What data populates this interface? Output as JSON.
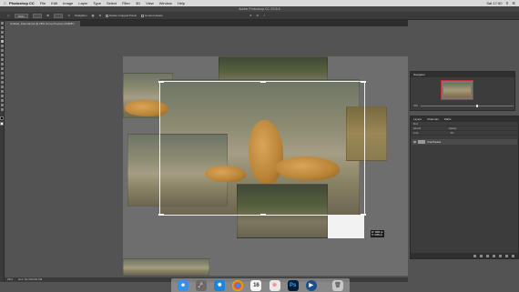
{
  "menubar": {
    "apple_icon": "apple-icon",
    "items": [
      "Photoshop CC",
      "File",
      "Edit",
      "Image",
      "Layer",
      "Type",
      "Select",
      "Filter",
      "3D",
      "View",
      "Window",
      "Help"
    ],
    "clock": "Sat 17:50"
  },
  "window": {
    "title": "Adobe Photoshop CC 2015.5"
  },
  "options": {
    "ratio_label": "Ratio",
    "straighten_label": "Straighten",
    "delete_pixels_label": "Delete Cropped Pixels",
    "content_aware_label": "Content-Aware"
  },
  "document_tab": {
    "label": "Untitled_Panorama1 @ 25% (Crop Preview, RGB/8*)"
  },
  "status": {
    "zoom": "25%",
    "doc_info": "Doc: 60.2M/240.9M"
  },
  "crop_info": {
    "line1": "W: 1680 px",
    "line2": "H: 1095 px"
  },
  "navigator": {
    "title": "Navigator",
    "zoom": "25%"
  },
  "layers": {
    "tabs": [
      "Layers",
      "Channels",
      "Paths"
    ],
    "kind_label": "Kind",
    "blend_mode": "Normal",
    "opacity_label": "Opacity:",
    "fill_label": "Fill:",
    "lock_label": "Lock:",
    "layer_name": "Crop Preview"
  },
  "dock": {
    "items": [
      {
        "icon": "finder-icon",
        "color": "#3b8ee8"
      },
      {
        "icon": "launchpad-icon",
        "color": "#6a6a6a"
      },
      {
        "icon": "safari-icon",
        "color": "#1a84e0"
      },
      {
        "icon": "chrome-icon",
        "color": "#db4437"
      },
      {
        "icon": "calendar-icon",
        "color": "#f5f5f5",
        "label": "16"
      },
      {
        "icon": "photos-icon",
        "color": "#e9e9e9"
      },
      {
        "icon": "photoshop-icon",
        "color": "#001e36",
        "label": "Ps"
      },
      {
        "icon": "quicktime-icon",
        "color": "#1c4f8c"
      },
      {
        "icon": "trash-icon",
        "color": "#c8c8c8"
      }
    ]
  }
}
